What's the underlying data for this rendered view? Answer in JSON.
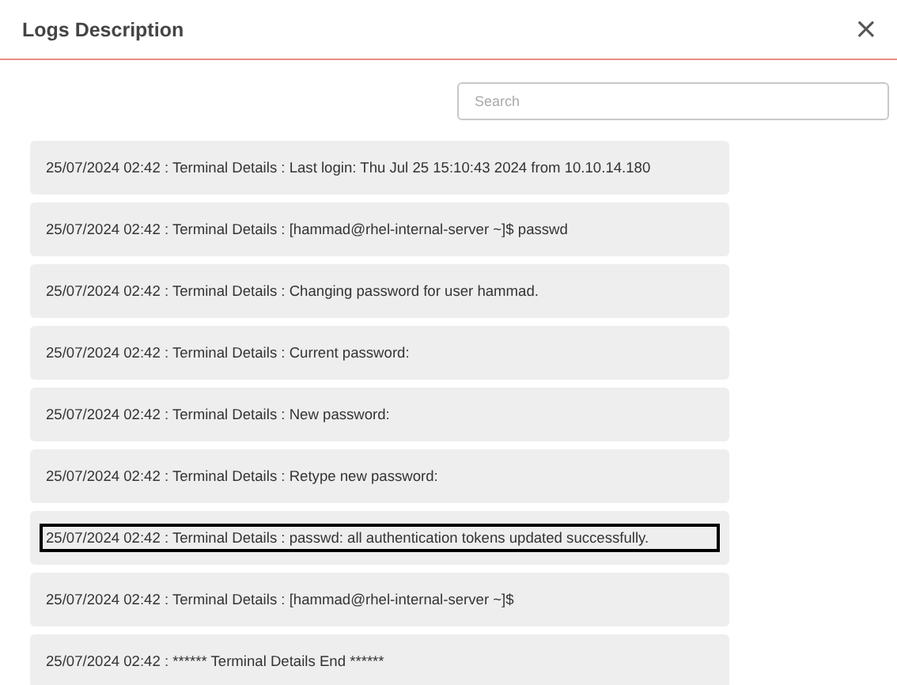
{
  "dialog": {
    "title": "Logs Description",
    "close": "×"
  },
  "search": {
    "placeholder": "Search"
  },
  "entries": [
    {
      "text": "25/07/2024 02:42 : Terminal Details : Last login: Thu Jul 25 15:10:43 2024 from 10.10.14.180",
      "highlighted": false
    },
    {
      "text": "25/07/2024 02:42 : Terminal Details : [hammad@rhel-internal-server ~]$ passwd",
      "highlighted": false
    },
    {
      "text": "25/07/2024 02:42 : Terminal Details : Changing password for user hammad.",
      "highlighted": false
    },
    {
      "text": "25/07/2024 02:42 : Terminal Details : Current password:",
      "highlighted": false
    },
    {
      "text": "25/07/2024 02:42 : Terminal Details : New password:",
      "highlighted": false
    },
    {
      "text": "25/07/2024 02:42 : Terminal Details : Retype new password:",
      "highlighted": false
    },
    {
      "text": "25/07/2024 02:42 : Terminal Details : passwd: all authentication tokens updated successfully.",
      "highlighted": true
    },
    {
      "text": "25/07/2024 02:42 : Terminal Details : [hammad@rhel-internal-server ~]$",
      "highlighted": false
    },
    {
      "text": "25/07/2024 02:42 : ****** Terminal Details End ******",
      "highlighted": false
    }
  ]
}
